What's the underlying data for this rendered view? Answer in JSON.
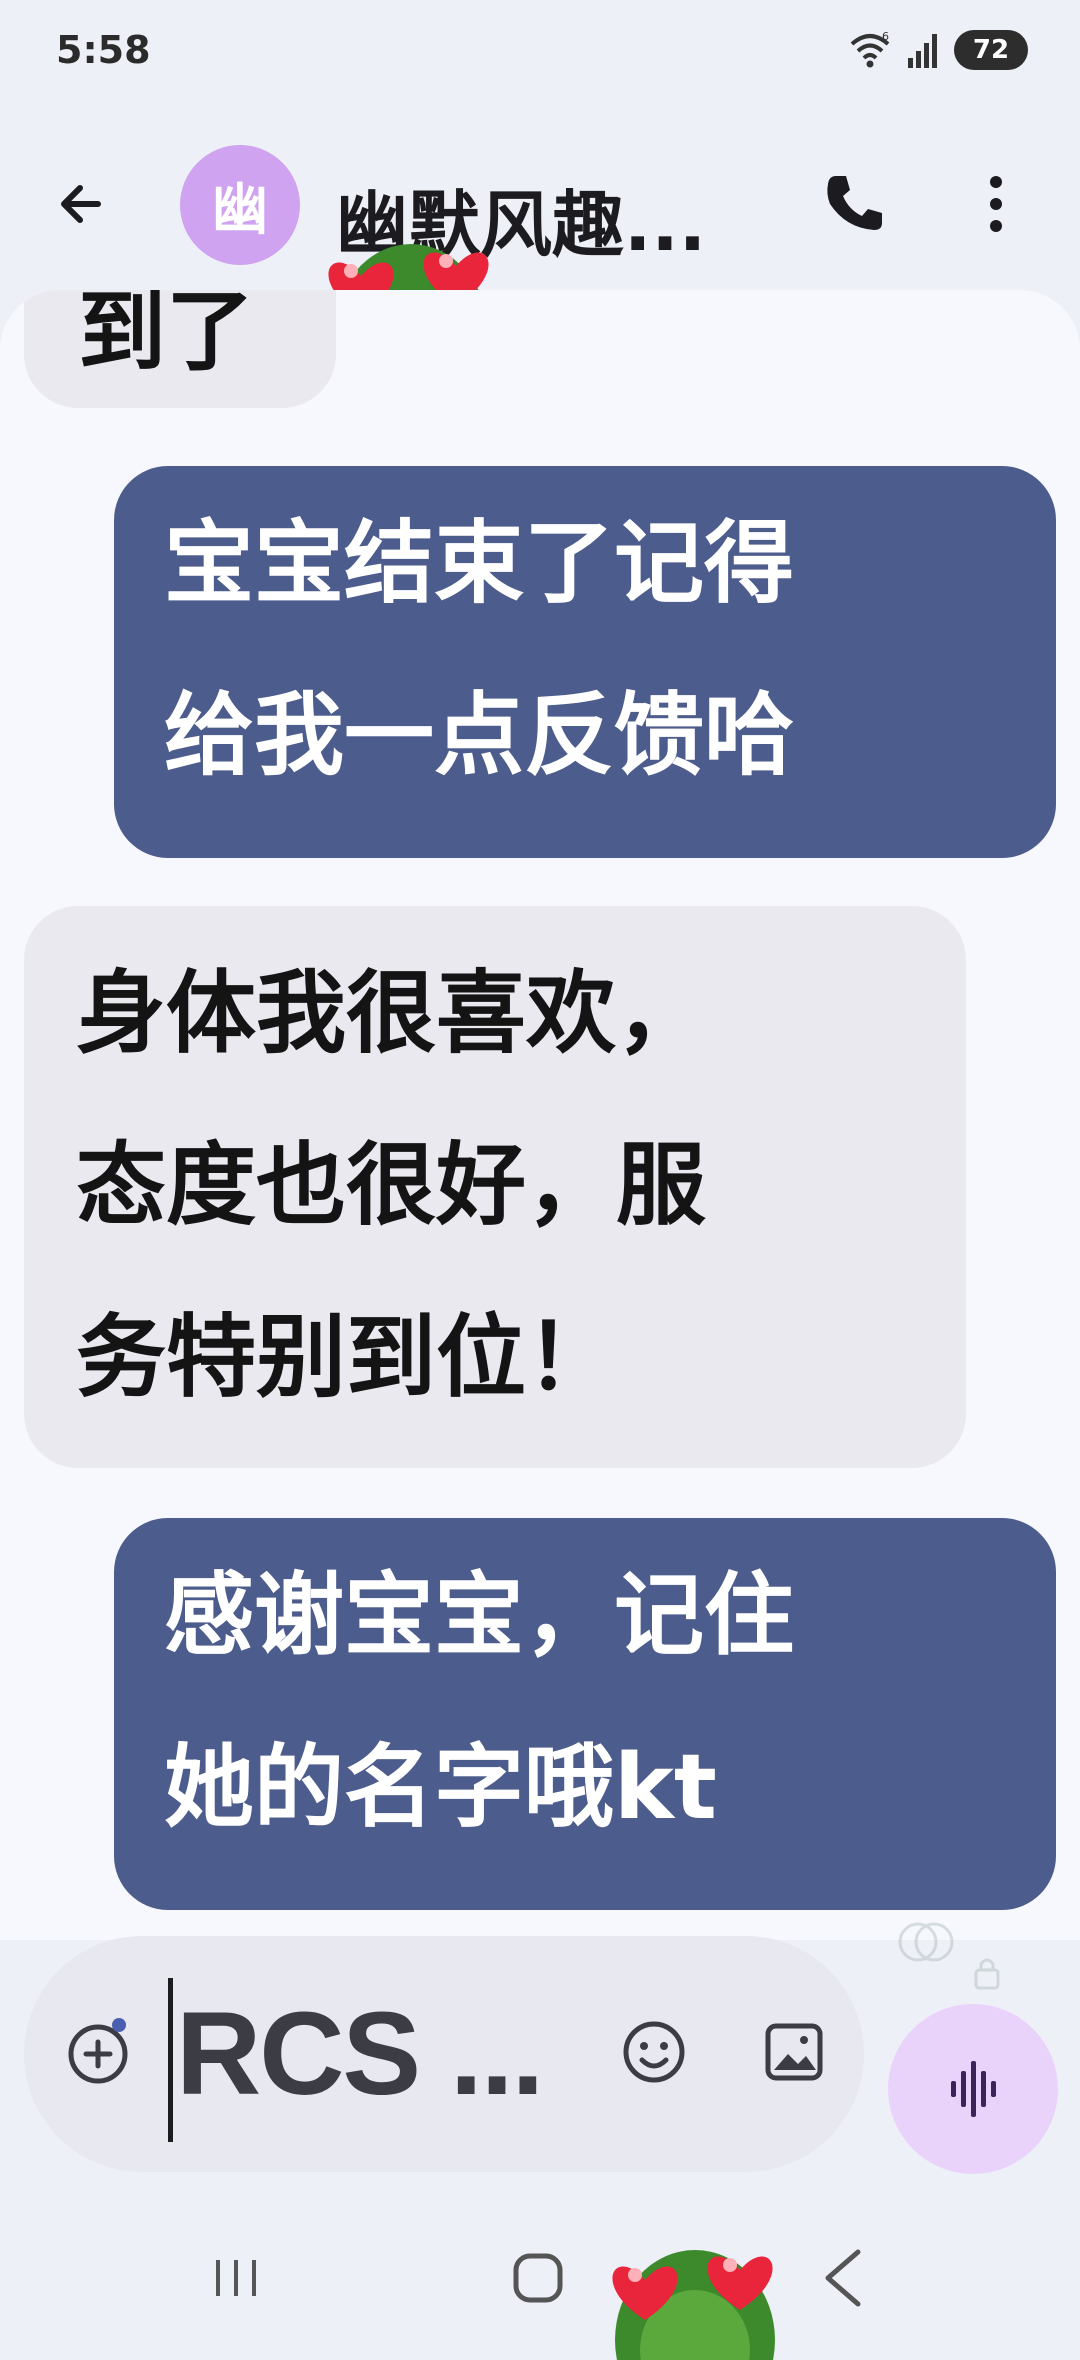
{
  "status_bar": {
    "time": "5:58",
    "battery": "72"
  },
  "header": {
    "avatar_letter": "幽",
    "contact_name": "幽默风趣..."
  },
  "messages": [
    {
      "direction": "incoming",
      "text": "到了"
    },
    {
      "direction": "outgoing",
      "text": "宝宝结束了记得\n给我一点反馈哈"
    },
    {
      "direction": "incoming",
      "text": "身体我很喜欢，\n态度也很好，服\n务特别到位！"
    },
    {
      "direction": "outgoing",
      "text": "感谢宝宝，记住\n她的名字哦kt"
    }
  ],
  "composer": {
    "input_value": "RCS ..."
  },
  "colors": {
    "outgoing_bubble": "#4c5c8c",
    "incoming_bubble": "#e9e9ef",
    "avatar": "#cfa3f0",
    "voice_button": "#ead3fb"
  }
}
